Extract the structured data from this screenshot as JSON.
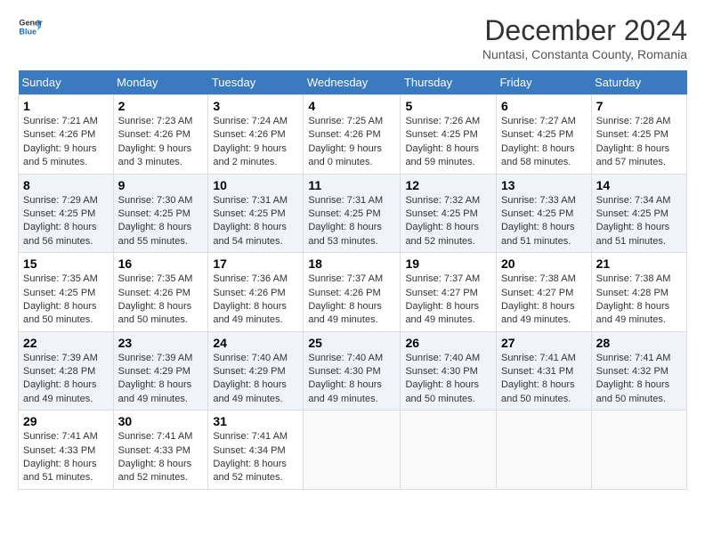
{
  "header": {
    "logo_line1": "General",
    "logo_line2": "Blue",
    "month_title": "December 2024",
    "location": "Nuntasi, Constanta County, Romania"
  },
  "weekdays": [
    "Sunday",
    "Monday",
    "Tuesday",
    "Wednesday",
    "Thursday",
    "Friday",
    "Saturday"
  ],
  "weeks": [
    [
      {
        "day": "1",
        "sunrise": "Sunrise: 7:21 AM",
        "sunset": "Sunset: 4:26 PM",
        "daylight": "Daylight: 9 hours and 5 minutes."
      },
      {
        "day": "2",
        "sunrise": "Sunrise: 7:23 AM",
        "sunset": "Sunset: 4:26 PM",
        "daylight": "Daylight: 9 hours and 3 minutes."
      },
      {
        "day": "3",
        "sunrise": "Sunrise: 7:24 AM",
        "sunset": "Sunset: 4:26 PM",
        "daylight": "Daylight: 9 hours and 2 minutes."
      },
      {
        "day": "4",
        "sunrise": "Sunrise: 7:25 AM",
        "sunset": "Sunset: 4:26 PM",
        "daylight": "Daylight: 9 hours and 0 minutes."
      },
      {
        "day": "5",
        "sunrise": "Sunrise: 7:26 AM",
        "sunset": "Sunset: 4:25 PM",
        "daylight": "Daylight: 8 hours and 59 minutes."
      },
      {
        "day": "6",
        "sunrise": "Sunrise: 7:27 AM",
        "sunset": "Sunset: 4:25 PM",
        "daylight": "Daylight: 8 hours and 58 minutes."
      },
      {
        "day": "7",
        "sunrise": "Sunrise: 7:28 AM",
        "sunset": "Sunset: 4:25 PM",
        "daylight": "Daylight: 8 hours and 57 minutes."
      }
    ],
    [
      {
        "day": "8",
        "sunrise": "Sunrise: 7:29 AM",
        "sunset": "Sunset: 4:25 PM",
        "daylight": "Daylight: 8 hours and 56 minutes."
      },
      {
        "day": "9",
        "sunrise": "Sunrise: 7:30 AM",
        "sunset": "Sunset: 4:25 PM",
        "daylight": "Daylight: 8 hours and 55 minutes."
      },
      {
        "day": "10",
        "sunrise": "Sunrise: 7:31 AM",
        "sunset": "Sunset: 4:25 PM",
        "daylight": "Daylight: 8 hours and 54 minutes."
      },
      {
        "day": "11",
        "sunrise": "Sunrise: 7:31 AM",
        "sunset": "Sunset: 4:25 PM",
        "daylight": "Daylight: 8 hours and 53 minutes."
      },
      {
        "day": "12",
        "sunrise": "Sunrise: 7:32 AM",
        "sunset": "Sunset: 4:25 PM",
        "daylight": "Daylight: 8 hours and 52 minutes."
      },
      {
        "day": "13",
        "sunrise": "Sunrise: 7:33 AM",
        "sunset": "Sunset: 4:25 PM",
        "daylight": "Daylight: 8 hours and 51 minutes."
      },
      {
        "day": "14",
        "sunrise": "Sunrise: 7:34 AM",
        "sunset": "Sunset: 4:25 PM",
        "daylight": "Daylight: 8 hours and 51 minutes."
      }
    ],
    [
      {
        "day": "15",
        "sunrise": "Sunrise: 7:35 AM",
        "sunset": "Sunset: 4:25 PM",
        "daylight": "Daylight: 8 hours and 50 minutes."
      },
      {
        "day": "16",
        "sunrise": "Sunrise: 7:35 AM",
        "sunset": "Sunset: 4:26 PM",
        "daylight": "Daylight: 8 hours and 50 minutes."
      },
      {
        "day": "17",
        "sunrise": "Sunrise: 7:36 AM",
        "sunset": "Sunset: 4:26 PM",
        "daylight": "Daylight: 8 hours and 49 minutes."
      },
      {
        "day": "18",
        "sunrise": "Sunrise: 7:37 AM",
        "sunset": "Sunset: 4:26 PM",
        "daylight": "Daylight: 8 hours and 49 minutes."
      },
      {
        "day": "19",
        "sunrise": "Sunrise: 7:37 AM",
        "sunset": "Sunset: 4:27 PM",
        "daylight": "Daylight: 8 hours and 49 minutes."
      },
      {
        "day": "20",
        "sunrise": "Sunrise: 7:38 AM",
        "sunset": "Sunset: 4:27 PM",
        "daylight": "Daylight: 8 hours and 49 minutes."
      },
      {
        "day": "21",
        "sunrise": "Sunrise: 7:38 AM",
        "sunset": "Sunset: 4:28 PM",
        "daylight": "Daylight: 8 hours and 49 minutes."
      }
    ],
    [
      {
        "day": "22",
        "sunrise": "Sunrise: 7:39 AM",
        "sunset": "Sunset: 4:28 PM",
        "daylight": "Daylight: 8 hours and 49 minutes."
      },
      {
        "day": "23",
        "sunrise": "Sunrise: 7:39 AM",
        "sunset": "Sunset: 4:29 PM",
        "daylight": "Daylight: 8 hours and 49 minutes."
      },
      {
        "day": "24",
        "sunrise": "Sunrise: 7:40 AM",
        "sunset": "Sunset: 4:29 PM",
        "daylight": "Daylight: 8 hours and 49 minutes."
      },
      {
        "day": "25",
        "sunrise": "Sunrise: 7:40 AM",
        "sunset": "Sunset: 4:30 PM",
        "daylight": "Daylight: 8 hours and 49 minutes."
      },
      {
        "day": "26",
        "sunrise": "Sunrise: 7:40 AM",
        "sunset": "Sunset: 4:30 PM",
        "daylight": "Daylight: 8 hours and 50 minutes."
      },
      {
        "day": "27",
        "sunrise": "Sunrise: 7:41 AM",
        "sunset": "Sunset: 4:31 PM",
        "daylight": "Daylight: 8 hours and 50 minutes."
      },
      {
        "day": "28",
        "sunrise": "Sunrise: 7:41 AM",
        "sunset": "Sunset: 4:32 PM",
        "daylight": "Daylight: 8 hours and 50 minutes."
      }
    ],
    [
      {
        "day": "29",
        "sunrise": "Sunrise: 7:41 AM",
        "sunset": "Sunset: 4:33 PM",
        "daylight": "Daylight: 8 hours and 51 minutes."
      },
      {
        "day": "30",
        "sunrise": "Sunrise: 7:41 AM",
        "sunset": "Sunset: 4:33 PM",
        "daylight": "Daylight: 8 hours and 52 minutes."
      },
      {
        "day": "31",
        "sunrise": "Sunrise: 7:41 AM",
        "sunset": "Sunset: 4:34 PM",
        "daylight": "Daylight: 8 hours and 52 minutes."
      },
      null,
      null,
      null,
      null
    ]
  ]
}
